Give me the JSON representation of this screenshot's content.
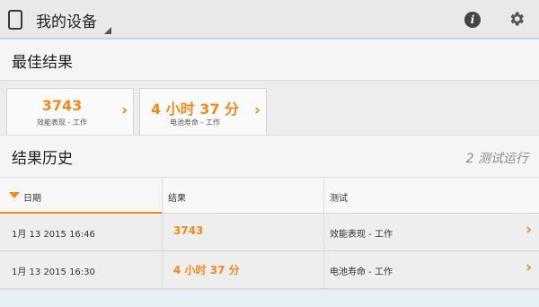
{
  "actionbar": {
    "title": "我的设备",
    "app_icon": "tablet-icon",
    "info_icon": "info-icon",
    "info_glyph": "i",
    "settings_icon": "gear-icon"
  },
  "best": {
    "title": "最佳结果",
    "cards": [
      {
        "value": "3743",
        "label": "效能表现 - 工作",
        "chevron": "›"
      },
      {
        "value": "4 小时 37 分",
        "label": "电池寿命 - 工作",
        "chevron": "›"
      }
    ]
  },
  "history": {
    "title": "结果历史",
    "run_count": "2 测试运行",
    "columns": {
      "date": "日期",
      "result": "结果",
      "test": "测试"
    },
    "rows": [
      {
        "date": "1月 13 2015 16:46",
        "result": "3743",
        "test": "效能表现 - 工作",
        "chevron": "›"
      },
      {
        "date": "1月 13 2015 16:30",
        "result": "4 小时 37 分",
        "test": "电池寿命 - 工作",
        "chevron": "›"
      }
    ]
  },
  "colors": {
    "accent": "#f08a1e",
    "actionbar_bg": "#e9e9e9",
    "section_bg": "#f5f5f5",
    "row_bg": "#eeeeee"
  }
}
